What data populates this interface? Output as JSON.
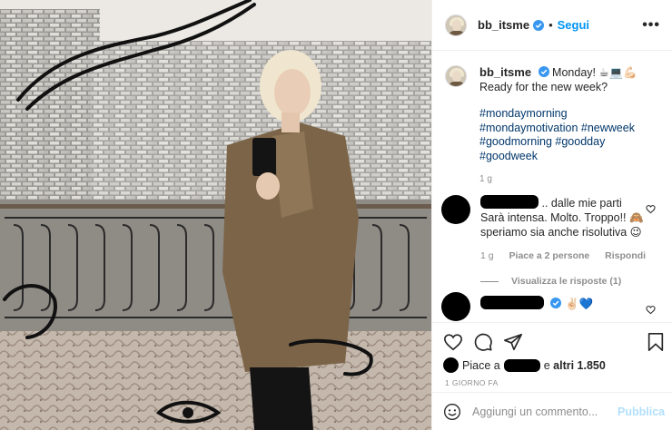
{
  "post": {
    "username": "bb_itsme",
    "follow_label": "Segui",
    "separator": "•",
    "more_label": "•••"
  },
  "caption": {
    "username": "bb_itsme",
    "text": "Monday! ☕💻💪🏻",
    "question": "Ready for the new week?",
    "hashtags": [
      "#mondaymorning",
      "#mondaymotivation",
      "#newweek",
      "#goodmorning",
      "#goodday",
      "#goodweek"
    ],
    "time": "1 g"
  },
  "comments": [
    {
      "text_line1": ".. dalle mie parti Sarà",
      "text_rest": "intensa. Molto. Troppo!! 🙈 speriamo sia anche risolutiva 😉",
      "time": "1 g",
      "likes": "Piace a 2 persone",
      "reply": "Rispondi",
      "view_replies": "Visualizza le risposte (1)"
    },
    {
      "emoji": "✌🏻💙"
    }
  ],
  "actions": {
    "likes_prefix": "Piace a",
    "likes_and": "e",
    "likes_others": "altri 1.850",
    "date": "1 GIORNO FA"
  },
  "add_comment": {
    "placeholder": "Aggiungi un commento...",
    "publish": "Pubblica"
  },
  "colors": {
    "accent": "#0095f6",
    "hashtag": "#00376b",
    "muted": "#8e8e8e",
    "publish_disabled": "#b2dffc"
  },
  "icons": [
    "heart-icon",
    "comment-icon",
    "share-icon",
    "bookmark-icon",
    "emoji-icon",
    "verified-icon",
    "more-icon"
  ]
}
